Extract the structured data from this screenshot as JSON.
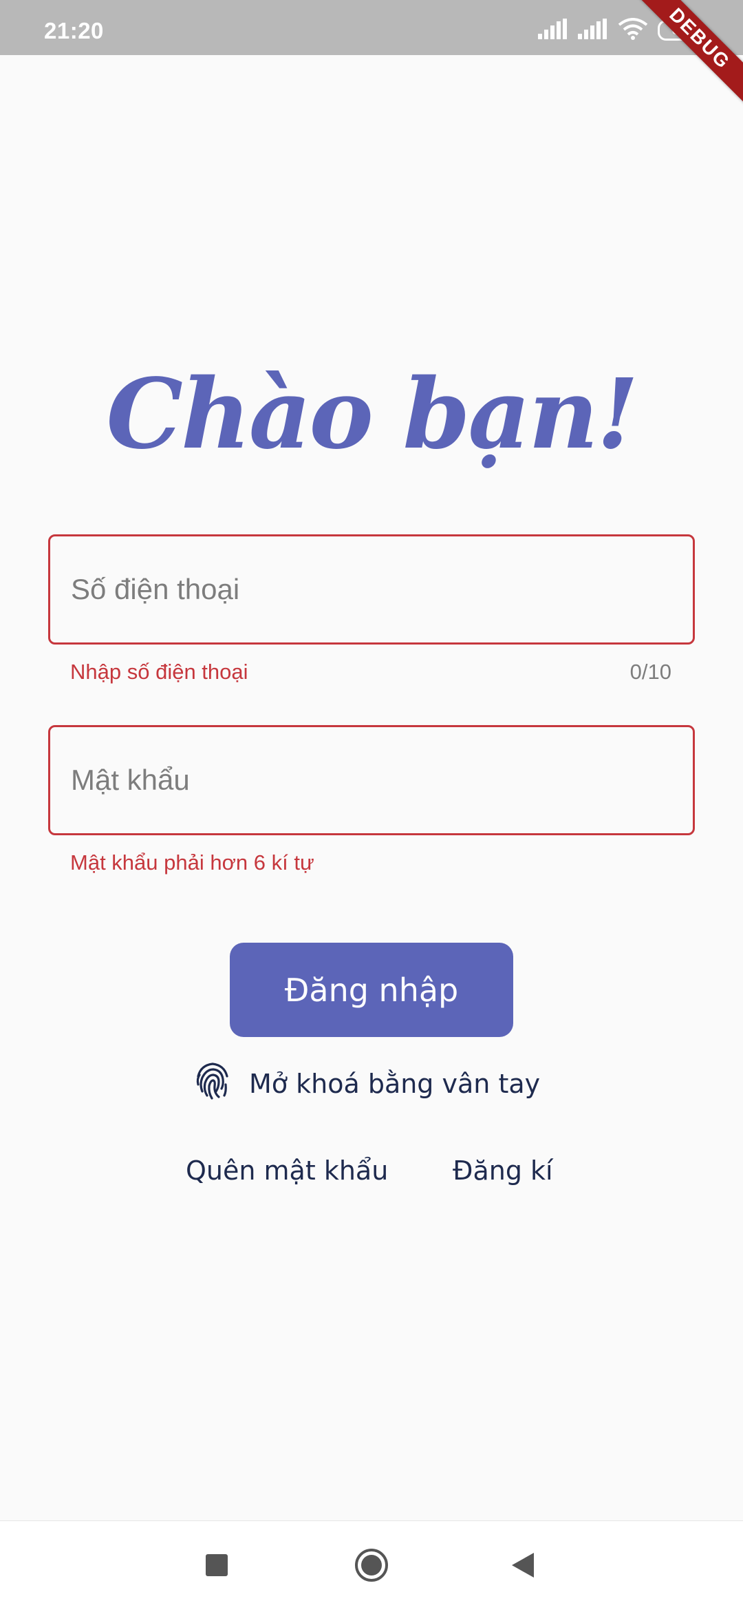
{
  "status_bar": {
    "time": "21:20",
    "battery": "85",
    "debug_banner": "DEBUG"
  },
  "greeting": "Chào bạn!",
  "phone_field": {
    "placeholder": "Số điện thoại",
    "value": "",
    "error": "Nhập số điện thoại",
    "counter": "0/10"
  },
  "password_field": {
    "placeholder": "Mật khẩu",
    "value": "",
    "error": "Mật khẩu phải hơn 6 kí tự"
  },
  "login_button": "Đăng nhập",
  "fingerprint_unlock": "Mở khoá bằng vân tay",
  "links": {
    "forgot_password": "Quên mật khẩu",
    "register": "Đăng kí"
  },
  "icons": {
    "signal": "signal-icon",
    "wifi": "wifi-icon",
    "battery": "battery-icon",
    "fingerprint": "fingerprint-icon",
    "nav_recents": "square-icon",
    "nav_home": "circle-icon",
    "nav_back": "triangle-back-icon"
  },
  "colors": {
    "accent": "#5c65b8",
    "error": "#c6373d",
    "text_dark": "#1e2a4e",
    "status_bar": "#b8b8b8"
  }
}
